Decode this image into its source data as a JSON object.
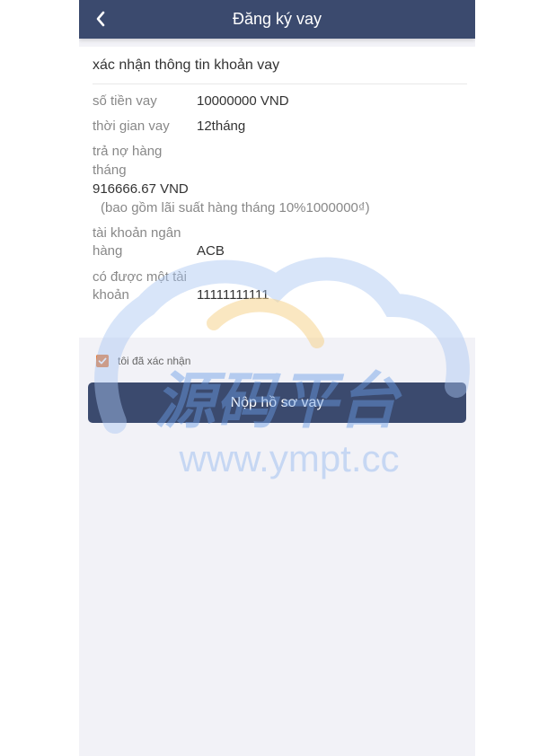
{
  "header": {
    "title": "Đăng ký vay"
  },
  "card": {
    "title": "xác nhận thông tin khoản vay",
    "amount": {
      "label": "số tiền vay",
      "value": "10000000 VND"
    },
    "term": {
      "label": "thời gian vay",
      "value": "12tháng"
    },
    "monthly": {
      "label_line1": "trả nợ hàng",
      "label_line2": "tháng",
      "value": "916666.67 VND",
      "note": "(bao gồm lãi suất hàng tháng 10%1000000₫)"
    },
    "bank": {
      "label_line1": "tài khoản ngân",
      "label_line2": "hàng",
      "value": "ACB"
    },
    "account": {
      "label_line1": "có được một tài",
      "label_line2": "khoản",
      "value": "11111111111"
    }
  },
  "confirm": {
    "label": "tôi đã xác nhận",
    "checked": true
  },
  "submit": {
    "label": "Nộp hồ sơ vay"
  },
  "watermark": {
    "logo_text": "源码平台",
    "url_text": "www.ympt.cc"
  },
  "colors": {
    "header": "#3b4a6e",
    "button": "#3b4a6e",
    "checkbox": "#e87a35",
    "background": "#f2f2f7"
  }
}
